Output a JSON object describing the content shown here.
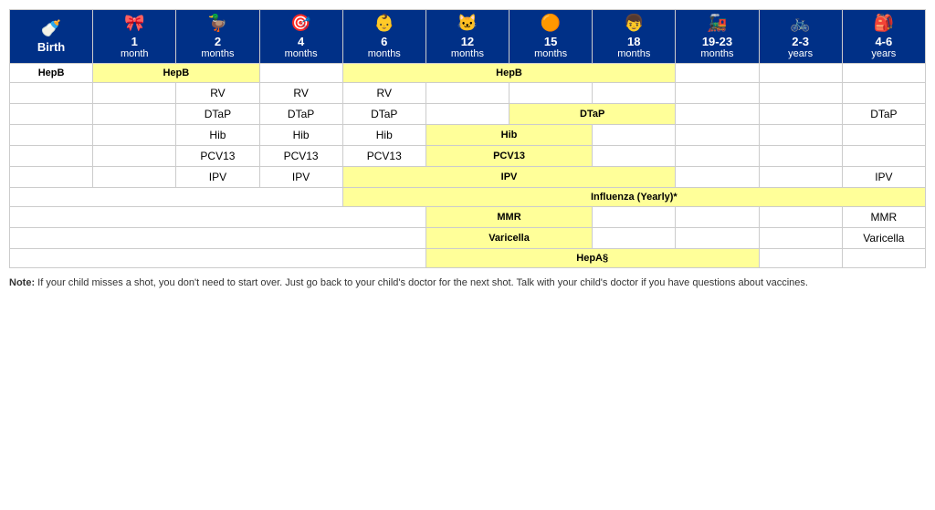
{
  "header": {
    "columns": [
      {
        "id": "birth",
        "icon": "🍼",
        "age": "Birth",
        "unit": ""
      },
      {
        "id": "1mo",
        "icon": "🎀",
        "age": "1",
        "unit": "month"
      },
      {
        "id": "2mo",
        "icon": "🦆",
        "age": "2",
        "unit": "months"
      },
      {
        "id": "4mo",
        "icon": "🎯",
        "age": "4",
        "unit": "months"
      },
      {
        "id": "6mo",
        "icon": "👶",
        "age": "6",
        "unit": "months"
      },
      {
        "id": "12mo",
        "icon": "🐱",
        "age": "12",
        "unit": "months"
      },
      {
        "id": "15mo",
        "icon": "🍊",
        "age": "15",
        "unit": "months"
      },
      {
        "id": "18mo",
        "icon": "👦",
        "age": "18",
        "unit": "months"
      },
      {
        "id": "19-23mo",
        "icon": "🚂",
        "age": "19-23",
        "unit": "months"
      },
      {
        "id": "2-3yr",
        "icon": "🚲",
        "age": "2-3",
        "unit": "years"
      },
      {
        "id": "4-6yr",
        "icon": "🎒",
        "age": "4-6",
        "unit": "years"
      }
    ]
  },
  "vaccines": [
    {
      "name": "HepB",
      "cells": [
        {
          "col": "birth",
          "text": "HepB",
          "yellow": false
        },
        {
          "col": "1mo",
          "text": "HepB",
          "yellow": true,
          "colspan": 2
        },
        {
          "col": "4mo",
          "text": "",
          "yellow": false
        },
        {
          "col": "6mo",
          "text": "HepB",
          "yellow": true,
          "colspan": 4
        },
        {
          "col": "15mo",
          "text": "",
          "yellow": false,
          "skip": true
        },
        {
          "col": "18mo",
          "text": "",
          "yellow": false,
          "skip": true
        },
        {
          "col": "19-23mo",
          "text": "",
          "yellow": false
        },
        {
          "col": "2-3yr",
          "text": "",
          "yellow": false
        },
        {
          "col": "4-6yr",
          "text": "",
          "yellow": false
        }
      ]
    }
  ],
  "rows": [
    {
      "label": "HepB",
      "cells": [
        "HepB_birth",
        "hepb_1_2_span",
        null,
        "hepb_4",
        "hepb_6_12_15_18_span",
        null,
        null,
        null,
        "",
        "",
        ""
      ]
    }
  ],
  "note": {
    "bold": "Note:",
    "text": " If your child misses a shot, you don't need to start over. Just go back to your child's doctor for the next shot. Talk with your child's doctor if you have questions about vaccines."
  },
  "table_data": {
    "hepb_row": {
      "label": "HepB",
      "birth": {
        "text": "HepB",
        "yellow": false
      },
      "1mo_2mo": {
        "text": "HepB",
        "yellow": true,
        "colspan": 2
      },
      "4mo": {
        "text": "",
        "yellow": false
      },
      "6mo_18mo": {
        "text": "HepB",
        "yellow": true,
        "colspan": 4
      },
      "19_23mo": {
        "text": "",
        "yellow": false
      },
      "2_3yr": {
        "text": "",
        "yellow": false
      },
      "4_6yr": {
        "text": "",
        "yellow": false
      }
    },
    "rv_row": {
      "label": "",
      "birth": {
        "text": "",
        "yellow": false
      },
      "1mo": {
        "text": "",
        "yellow": false
      },
      "2mo": {
        "text": "RV",
        "yellow": false
      },
      "4mo": {
        "text": "RV",
        "yellow": false
      },
      "6mo": {
        "text": "RV",
        "yellow": false
      },
      "12mo": {
        "text": "",
        "yellow": false
      },
      "15mo": {
        "text": "",
        "yellow": false
      },
      "18mo": {
        "text": "",
        "yellow": false
      },
      "19_23mo": {
        "text": "",
        "yellow": false
      },
      "2_3yr": {
        "text": "",
        "yellow": false
      },
      "4_6yr": {
        "text": "",
        "yellow": false
      }
    },
    "dtap_row": {
      "label": "",
      "birth": {
        "text": "",
        "yellow": false
      },
      "1mo": {
        "text": "",
        "yellow": false
      },
      "2mo": {
        "text": "DTaP",
        "yellow": false
      },
      "4mo": {
        "text": "DTaP",
        "yellow": false
      },
      "6mo": {
        "text": "DTaP",
        "yellow": false
      },
      "12mo": {
        "text": "",
        "yellow": false
      },
      "15mo_18mo": {
        "text": "DTaP",
        "yellow": true,
        "colspan": 2
      },
      "19_23mo": {
        "text": "",
        "yellow": false
      },
      "2_3yr": {
        "text": "",
        "yellow": false
      },
      "4_6yr": {
        "text": "DTaP",
        "yellow": false
      }
    },
    "hib_row": {
      "label": "",
      "birth": {
        "text": "",
        "yellow": false
      },
      "1mo": {
        "text": "",
        "yellow": false
      },
      "2mo": {
        "text": "Hib",
        "yellow": false
      },
      "4mo": {
        "text": "Hib",
        "yellow": false
      },
      "6mo": {
        "text": "Hib",
        "yellow": false
      },
      "12mo_15mo": {
        "text": "Hib",
        "yellow": true,
        "colspan": 2
      },
      "18mo": {
        "text": "",
        "yellow": false
      },
      "19_23mo": {
        "text": "",
        "yellow": false
      },
      "2_3yr": {
        "text": "",
        "yellow": false
      },
      "4_6yr": {
        "text": "",
        "yellow": false
      }
    },
    "pcv13_row": {
      "label": "",
      "birth": {
        "text": "",
        "yellow": false
      },
      "1mo": {
        "text": "",
        "yellow": false
      },
      "2mo": {
        "text": "PCV13",
        "yellow": false
      },
      "4mo": {
        "text": "PCV13",
        "yellow": false
      },
      "6mo": {
        "text": "PCV13",
        "yellow": false
      },
      "12mo_15mo": {
        "text": "PCV13",
        "yellow": true,
        "colspan": 2
      },
      "18mo": {
        "text": "",
        "yellow": false
      },
      "19_23mo": {
        "text": "",
        "yellow": false
      },
      "2_3yr": {
        "text": "",
        "yellow": false
      },
      "4_6yr": {
        "text": "",
        "yellow": false
      }
    },
    "ipv_row": {
      "label": "",
      "birth": {
        "text": "",
        "yellow": false
      },
      "1mo": {
        "text": "",
        "yellow": false
      },
      "2mo": {
        "text": "IPV",
        "yellow": false
      },
      "4mo": {
        "text": "IPV",
        "yellow": false
      },
      "6mo_18mo": {
        "text": "IPV",
        "yellow": true,
        "colspan": 4
      },
      "19_23mo": {
        "text": "",
        "yellow": false
      },
      "2_3yr": {
        "text": "",
        "yellow": false
      },
      "4_6yr": {
        "text": "IPV",
        "yellow": false
      }
    },
    "influenza_row": {
      "label": "",
      "birth_4mo": {
        "text": "",
        "yellow": false,
        "colspan": 4
      },
      "6mo_2_3yr": {
        "text": "Influenza (Yearly)*",
        "yellow": true,
        "colspan": 7
      }
    },
    "mmr_row": {
      "label": "",
      "birth_5mo": {
        "text": "",
        "yellow": false,
        "colspan": 5
      },
      "6mo_15mo": {
        "text": "MMR",
        "yellow": true,
        "colspan": 2
      },
      "18mo": {
        "text": "",
        "yellow": false
      },
      "19_23mo": {
        "text": "",
        "yellow": false
      },
      "2_3yr": {
        "text": "",
        "yellow": false
      },
      "4_6yr": {
        "text": "MMR",
        "yellow": false
      }
    },
    "varicella_row": {
      "label": "",
      "birth_5mo": {
        "text": "",
        "yellow": false,
        "colspan": 5
      },
      "6mo_15mo": {
        "text": "Varicella",
        "yellow": true,
        "colspan": 2
      },
      "18mo": {
        "text": "",
        "yellow": false
      },
      "19_23mo": {
        "text": "",
        "yellow": false
      },
      "2_3yr": {
        "text": "",
        "yellow": false
      },
      "4_6yr": {
        "text": "Varicella",
        "yellow": false
      }
    },
    "hepa_row": {
      "label": "",
      "birth_5mo": {
        "text": "",
        "yellow": false,
        "colspan": 5
      },
      "6mo_18mo": {
        "text": "HepA§",
        "yellow": true,
        "colspan": 5
      },
      "2_3yr": {
        "text": "",
        "yellow": false
      },
      "4_6yr": {
        "text": "",
        "yellow": false
      }
    }
  }
}
